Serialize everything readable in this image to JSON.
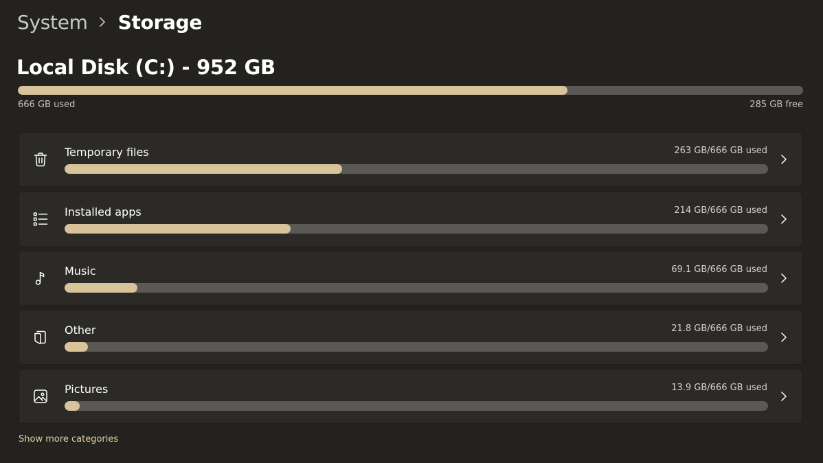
{
  "breadcrumb": {
    "parent": "System",
    "current": "Storage"
  },
  "disk": {
    "title": "Local Disk (C:) - 952 GB",
    "used_label": "666 GB used",
    "free_label": "285 GB free",
    "used_fraction": 0.7
  },
  "categories": [
    {
      "label": "Temporary files",
      "usage": "263 GB/666 GB used",
      "fraction": 0.395,
      "icon": "trash-icon"
    },
    {
      "label": "Installed apps",
      "usage": "214 GB/666 GB used",
      "fraction": 0.321,
      "icon": "list-icon"
    },
    {
      "label": "Music",
      "usage": "69.1 GB/666 GB used",
      "fraction": 0.104,
      "icon": "music-note-icon"
    },
    {
      "label": "Other",
      "usage": "21.8 GB/666 GB used",
      "fraction": 0.033,
      "icon": "document-icon"
    },
    {
      "label": "Pictures",
      "usage": "13.9 GB/666 GB used",
      "fraction": 0.021,
      "icon": "picture-icon"
    }
  ],
  "show_more": "Show more categories",
  "colors": {
    "background": "#23221f",
    "card": "#2b2a27",
    "bar_fill": "#d8c39a",
    "bar_track": "#5a5955",
    "link": "#ded29f"
  }
}
